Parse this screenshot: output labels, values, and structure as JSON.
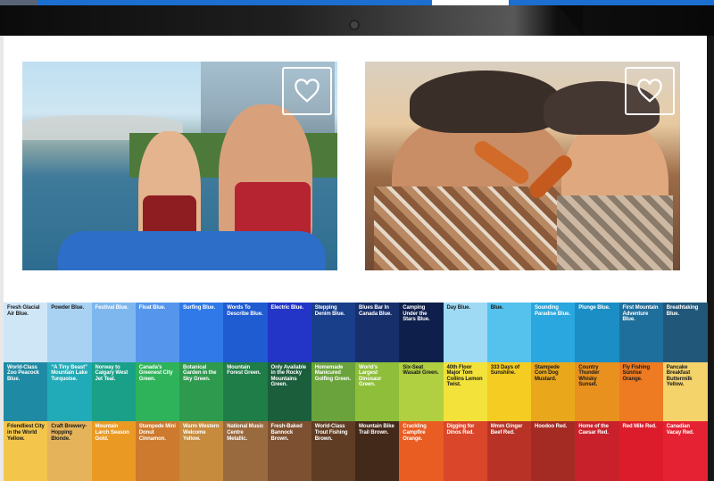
{
  "favorite_icon": "heart-outline-icon",
  "swatch_rows": [
    [
      {
        "label": "Fresh Glacial Air Blue.",
        "color": "#cfe6f7",
        "text": "dark"
      },
      {
        "label": "Powder Blue.",
        "color": "#a9d2f2",
        "text": "dark"
      },
      {
        "label": "Festival Blue.",
        "color": "#7eb7ee",
        "text": "light"
      },
      {
        "label": "Float Blue.",
        "color": "#5596ec",
        "text": "light"
      },
      {
        "label": "Surfing Blue.",
        "color": "#2f7ae8",
        "text": "light"
      },
      {
        "label": "Words To Describe Blue.",
        "color": "#1f5bd1",
        "text": "light"
      },
      {
        "label": "Electric Blue.",
        "color": "#2335c7",
        "text": "light"
      },
      {
        "label": "Stepping Denim Blue.",
        "color": "#1a3f8a",
        "text": "light"
      },
      {
        "label": "Blues Bar In Canada Blue.",
        "color": "#17306b",
        "text": "light"
      },
      {
        "label": "Camping Under the Stars Blue.",
        "color": "#0f1f4b",
        "text": "light"
      },
      {
        "label": "Day Blue.",
        "color": "#9fdaf5",
        "text": "dark"
      },
      {
        "label": "Blue.",
        "color": "#55c2ee",
        "text": "dark"
      },
      {
        "label": "Sounding Paradise Blue.",
        "color": "#2aa7de",
        "text": "light"
      },
      {
        "label": "Plunge Blue.",
        "color": "#1b8ec6",
        "text": "light"
      },
      {
        "label": "First Mountain Adventure Blue.",
        "color": "#1f6f9c",
        "text": "light"
      },
      {
        "label": "Breathtaking Blue.",
        "color": "#21587a",
        "text": "light"
      }
    ],
    [
      {
        "label": "World-Class Zoo Peacock Blue.",
        "color": "#1f8aa3",
        "text": "light"
      },
      {
        "label": "“A Tiny Beast” Mountain Lake Turquoise.",
        "color": "#21aab7",
        "text": "light"
      },
      {
        "label": "Norway to Calgary West Jet Teal.",
        "color": "#1aa089",
        "text": "light"
      },
      {
        "label": "Canada’s Greenest City Green.",
        "color": "#2fb35a",
        "text": "light"
      },
      {
        "label": "Botanical Garden in the Sky Green.",
        "color": "#2e9a4e",
        "text": "light"
      },
      {
        "label": "Mountain Forest Green.",
        "color": "#1f7d48",
        "text": "light"
      },
      {
        "label": "Only Available in the Rocky Mountains Green.",
        "color": "#1b5e3c",
        "text": "light"
      },
      {
        "label": "Homemade Manicured Golfing Green.",
        "color": "#6aa33b",
        "text": "light"
      },
      {
        "label": "World’s Largest Dinosaur Green.",
        "color": "#8fbf3a",
        "text": "light"
      },
      {
        "label": "Six-Seat Wasabi Green.",
        "color": "#b0cf41",
        "text": "dark"
      },
      {
        "label": "40th Floor Major Tom Collins Lemon Twist.",
        "color": "#f2e23a",
        "text": "dark"
      },
      {
        "label": "333 Days of Sunshine.",
        "color": "#f5cc22",
        "text": "dark"
      },
      {
        "label": "Stampede Corn Dog Mustard.",
        "color": "#e9a81c",
        "text": "dark"
      },
      {
        "label": "Country Thunder Whisky Sunset.",
        "color": "#e9911f",
        "text": "dark"
      },
      {
        "label": "Fly Fishing Sunrise Orange.",
        "color": "#ee7b22",
        "text": "dark"
      },
      {
        "label": "Pancake Breakfast Buttermilk Yellow.",
        "color": "#f4d36a",
        "text": "dark"
      }
    ],
    [
      {
        "label": "Friendliest City in the World Yellow.",
        "color": "#f3c64b",
        "text": "dark"
      },
      {
        "label": "Craft Brewery-Hopping Blonde.",
        "color": "#e5b45a",
        "text": "dark"
      },
      {
        "label": "Mountain Larch Season Gold.",
        "color": "#ea9a23",
        "text": "light"
      },
      {
        "label": "Stampede Mini Donut Cinnamon.",
        "color": "#cd7a2e",
        "text": "light"
      },
      {
        "label": "Warm Western Welcome Yellow.",
        "color": "#c68b3d",
        "text": "light"
      },
      {
        "label": "National Music Centre Metallic.",
        "color": "#9a6a3f",
        "text": "light"
      },
      {
        "label": "Fresh-Baked Bannock Brown.",
        "color": "#7c5030",
        "text": "light"
      },
      {
        "label": "World-Class Trout Fishing Brown.",
        "color": "#5f3d24",
        "text": "light"
      },
      {
        "label": "Mountain Bike Trail Brown.",
        "color": "#43291a",
        "text": "light"
      },
      {
        "label": "Crackling Campfire Orange.",
        "color": "#e95d23",
        "text": "light"
      },
      {
        "label": "Digging for Dinos Red.",
        "color": "#d9462a",
        "text": "light"
      },
      {
        "label": "Mmm Ginger Beef Red.",
        "color": "#b83326",
        "text": "light"
      },
      {
        "label": "Hoodoo Red.",
        "color": "#a42b24",
        "text": "light"
      },
      {
        "label": "Home of the Caesar Red.",
        "color": "#c8212b",
        "text": "light"
      },
      {
        "label": "Red Mile Red.",
        "color": "#dd1c2b",
        "text": "light"
      },
      {
        "label": "Canadian Vacay Red.",
        "color": "#e52233",
        "text": "light"
      }
    ]
  ]
}
